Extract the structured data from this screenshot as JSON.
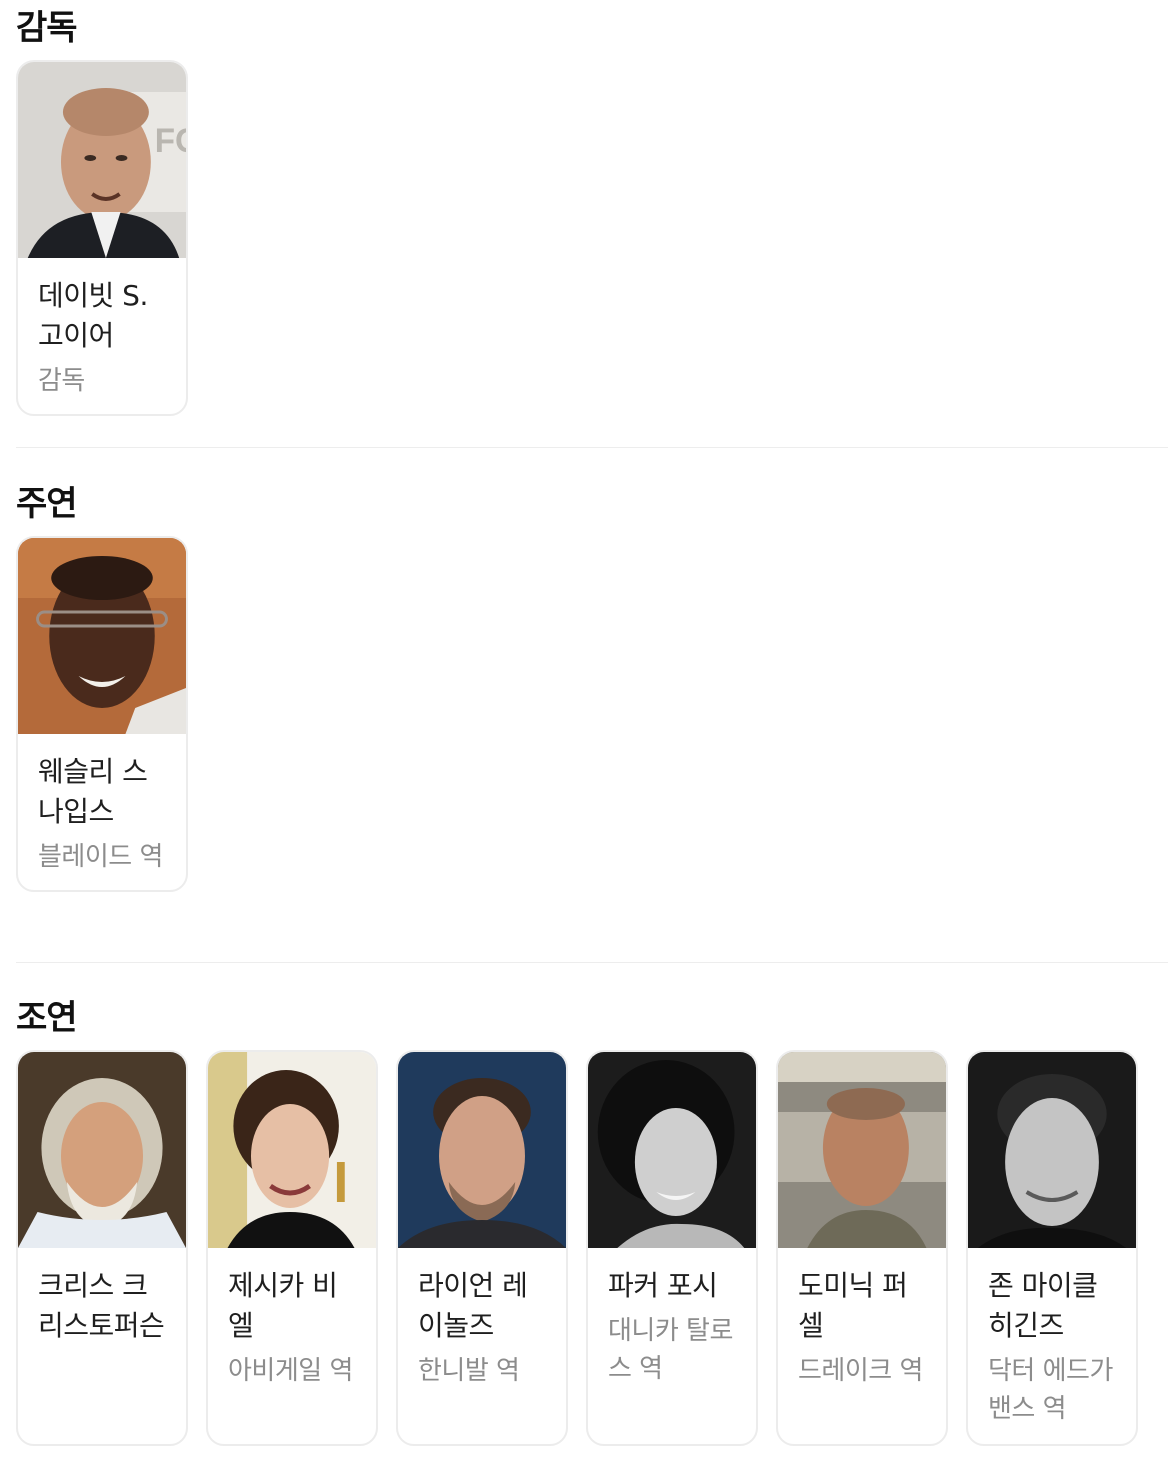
{
  "sections": [
    {
      "title": "감독",
      "people": [
        {
          "name": "데이빗 S. 고이어",
          "role": "감독",
          "photo": "director-portrait"
        }
      ]
    },
    {
      "title": "주연",
      "people": [
        {
          "name": "웨슬리 스나입스",
          "role": "블레이드 역",
          "photo": "lead-actor-portrait"
        }
      ]
    },
    {
      "title": "조연",
      "people": [
        {
          "name": "크리스 크리스토퍼슨",
          "role": "",
          "photo": "supporting-actor-portrait"
        },
        {
          "name": "제시카 비엘",
          "role": "아비게일 역",
          "photo": "supporting-actor-portrait"
        },
        {
          "name": "라이언 레이놀즈",
          "role": "한니발 역",
          "photo": "supporting-actor-portrait"
        },
        {
          "name": "파커 포시",
          "role": "대니카 탈로스 역",
          "photo": "supporting-actor-portrait"
        },
        {
          "name": "도미닉 퍼셀",
          "role": "드레이크 역",
          "photo": "supporting-actor-portrait"
        },
        {
          "name": "존 마이클 히긴즈",
          "role": "닥터 에드가 밴스 역",
          "photo": "supporting-actor-portrait"
        }
      ]
    }
  ],
  "colors": {
    "card_border": "#ececec",
    "role_text": "#8c8c8c",
    "name_text": "#1f1f1f",
    "divider": "#ededed"
  }
}
